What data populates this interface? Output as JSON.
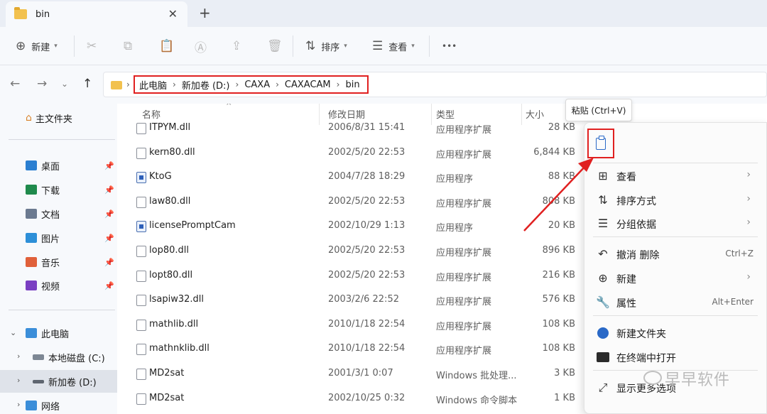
{
  "tab": {
    "title": "bin",
    "close": "✕",
    "new_tab": "+"
  },
  "toolbar": {
    "new_label": "新建",
    "sort_label": "排序",
    "view_label": "查看",
    "more": "•••"
  },
  "address": {
    "crumbs": [
      "此电脑",
      "新加卷 (D:)",
      "CAXA",
      "CAXACAM",
      "bin"
    ]
  },
  "sidebar": {
    "home": "主文件夹",
    "quick": [
      {
        "label": "桌面",
        "color": "#2b7fd1"
      },
      {
        "label": "下载",
        "color": "#1f8a4c"
      },
      {
        "label": "文档",
        "color": "#6b7a90"
      },
      {
        "label": "图片",
        "color": "#2d8fd8"
      },
      {
        "label": "音乐",
        "color": "#e0603a"
      },
      {
        "label": "视频",
        "color": "#7a3fc2"
      }
    ],
    "this_pc": "此电脑",
    "drives": [
      "本地磁盘 (C:)",
      "新加卷 (D:)"
    ],
    "network": "网络"
  },
  "columns": {
    "name": "名称",
    "date": "修改日期",
    "type": "类型",
    "size": "大小"
  },
  "files": [
    {
      "name": "ITPYM.dll",
      "date": "2006/8/31 15:41",
      "type": "应用程序扩展",
      "size": "28 KB",
      "kind": "dll"
    },
    {
      "name": "kern80.dll",
      "date": "2002/5/20 22:53",
      "type": "应用程序扩展",
      "size": "6,844 KB",
      "kind": "dll"
    },
    {
      "name": "KtoG",
      "date": "2004/7/28 18:29",
      "type": "应用程序",
      "size": "88 KB",
      "kind": "app"
    },
    {
      "name": "law80.dll",
      "date": "2002/5/20 22:53",
      "type": "应用程序扩展",
      "size": "808 KB",
      "kind": "dll"
    },
    {
      "name": "licensePromptCam",
      "date": "2002/10/29 1:13",
      "type": "应用程序",
      "size": "20 KB",
      "kind": "app"
    },
    {
      "name": "lop80.dll",
      "date": "2002/5/20 22:53",
      "type": "应用程序扩展",
      "size": "896 KB",
      "kind": "dll"
    },
    {
      "name": "lopt80.dll",
      "date": "2002/5/20 22:53",
      "type": "应用程序扩展",
      "size": "216 KB",
      "kind": "dll"
    },
    {
      "name": "lsapiw32.dll",
      "date": "2003/2/6 22:52",
      "type": "应用程序扩展",
      "size": "576 KB",
      "kind": "dll"
    },
    {
      "name": "mathlib.dll",
      "date": "2010/1/18 22:54",
      "type": "应用程序扩展",
      "size": "108 KB",
      "kind": "dll"
    },
    {
      "name": "mathnklib.dll",
      "date": "2010/1/18 22:54",
      "type": "应用程序扩展",
      "size": "108 KB",
      "kind": "dll"
    },
    {
      "name": "MD2sat",
      "date": "2001/3/1 0:07",
      "type": "Windows 批处理...",
      "size": "3 KB",
      "kind": "bat"
    },
    {
      "name": "MD2sat",
      "date": "2002/10/25 0:32",
      "type": "Windows 命令脚本",
      "size": "1 KB",
      "kind": "cmd"
    }
  ],
  "tooltip": "粘贴 (Ctrl+V)",
  "menu": {
    "items": [
      {
        "label": "查看",
        "icon": "grid-icon",
        "glyph": "⊞",
        "shortcut": "",
        "submenu": true
      },
      {
        "label": "排序方式",
        "icon": "sort-icon",
        "glyph": "⇅",
        "shortcut": "",
        "submenu": true
      },
      {
        "label": "分组依据",
        "icon": "group-icon",
        "glyph": "☰",
        "shortcut": "",
        "submenu": true
      },
      {
        "label": "撤消 删除",
        "icon": "undo-icon",
        "glyph": "↶",
        "shortcut": "Ctrl+Z",
        "submenu": false
      },
      {
        "label": "新建",
        "icon": "new-icon",
        "glyph": "⊕",
        "shortcut": "",
        "submenu": true
      },
      {
        "label": "属性",
        "icon": "wrench-icon",
        "glyph": "🔧",
        "shortcut": "Alt+Enter",
        "submenu": false
      },
      {
        "label": "新建文件夹",
        "icon": "new-folder-icon",
        "glyph": "",
        "shortcut": "",
        "submenu": false
      },
      {
        "label": "在终端中打开",
        "icon": "terminal-icon",
        "glyph": "",
        "shortcut": "",
        "submenu": false
      },
      {
        "label": "显示更多选项",
        "icon": "more-options-icon",
        "glyph": "⤢",
        "shortcut": "",
        "submenu": false
      }
    ],
    "submenu_glyph": "›"
  },
  "watermark": "早早软件",
  "colors": {
    "highlight": "#e02020",
    "accent": "#2a69c7"
  }
}
